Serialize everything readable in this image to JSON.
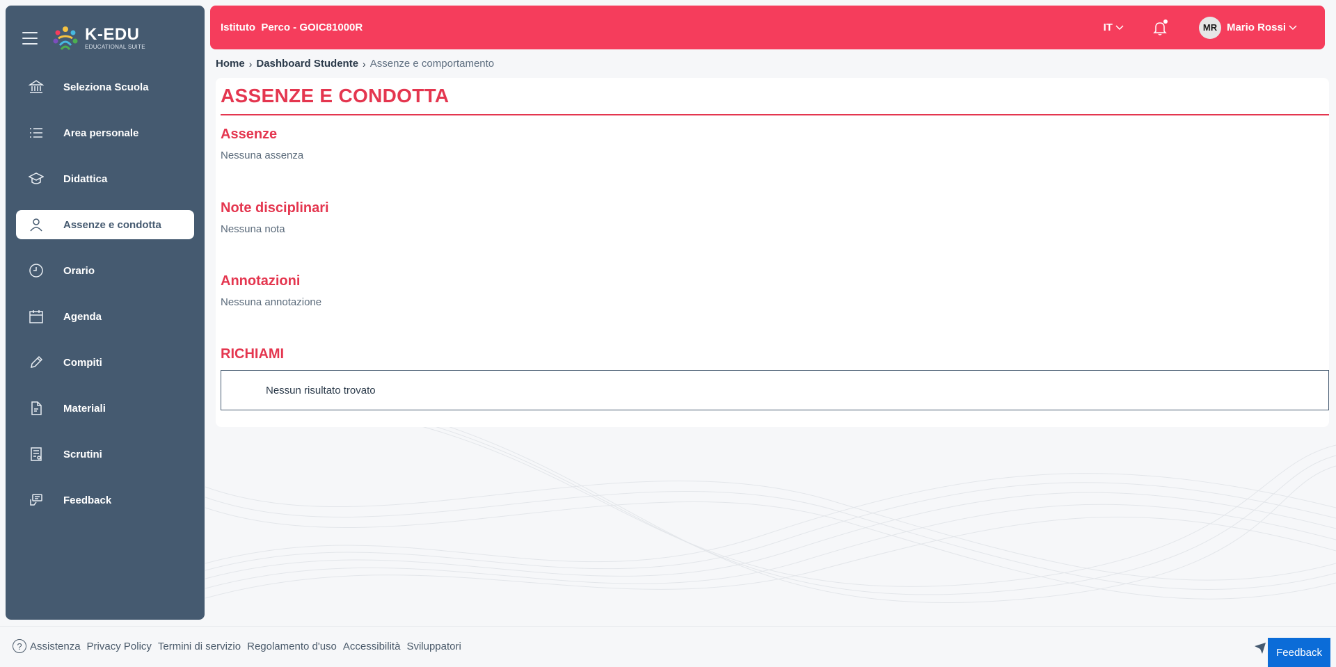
{
  "brand": {
    "title": "K-EDU",
    "subtitle": "EDUCATIONAL SUITE"
  },
  "sidebar": {
    "items": [
      {
        "label": "Seleziona Scuola",
        "icon": "bank-icon"
      },
      {
        "label": "Area personale",
        "icon": "list-icon"
      },
      {
        "label": "Didattica",
        "icon": "graduation-cap-icon"
      },
      {
        "label": "Assenze e condotta",
        "icon": "user-icon",
        "active": true
      },
      {
        "label": "Orario",
        "icon": "clock-icon"
      },
      {
        "label": "Agenda",
        "icon": "calendar-icon"
      },
      {
        "label": "Compiti",
        "icon": "pencil-icon"
      },
      {
        "label": "Materiali",
        "icon": "document-icon"
      },
      {
        "label": "Scrutini",
        "icon": "report-icon"
      },
      {
        "label": "Feedback",
        "icon": "feedback-icon"
      }
    ]
  },
  "header": {
    "school": "Istituto  Perco - GOIC81000R",
    "language": "IT",
    "user_initials": "MR",
    "user_name": "Mario Rossi"
  },
  "breadcrumb": {
    "home": "Home",
    "dashboard": "Dashboard Studente",
    "current": "Assenze e comportamento"
  },
  "main": {
    "title": "ASSENZE E CONDOTTA",
    "sections": [
      {
        "heading": "Assenze",
        "text": "Nessuna assenza"
      },
      {
        "heading": "Note disciplinari",
        "text": "Nessuna nota"
      },
      {
        "heading": "Annotazioni",
        "text": "Nessuna annotazione"
      },
      {
        "heading": "RICHIAMI",
        "text": ""
      }
    ],
    "richiami_empty": "Nessun risultato trovato"
  },
  "footer": {
    "links": [
      "Assistenza",
      "Privacy Policy",
      "Termini di servizio",
      "Regolamento d'uso",
      "Accessibilità",
      "Sviluppatori"
    ],
    "feedback_label": "Feedback"
  },
  "colors": {
    "sidebar_bg": "#455a70",
    "header_bg": "#f53d5c",
    "accent_red": "#e4364f",
    "feedback_blue": "#0b6cd8"
  }
}
